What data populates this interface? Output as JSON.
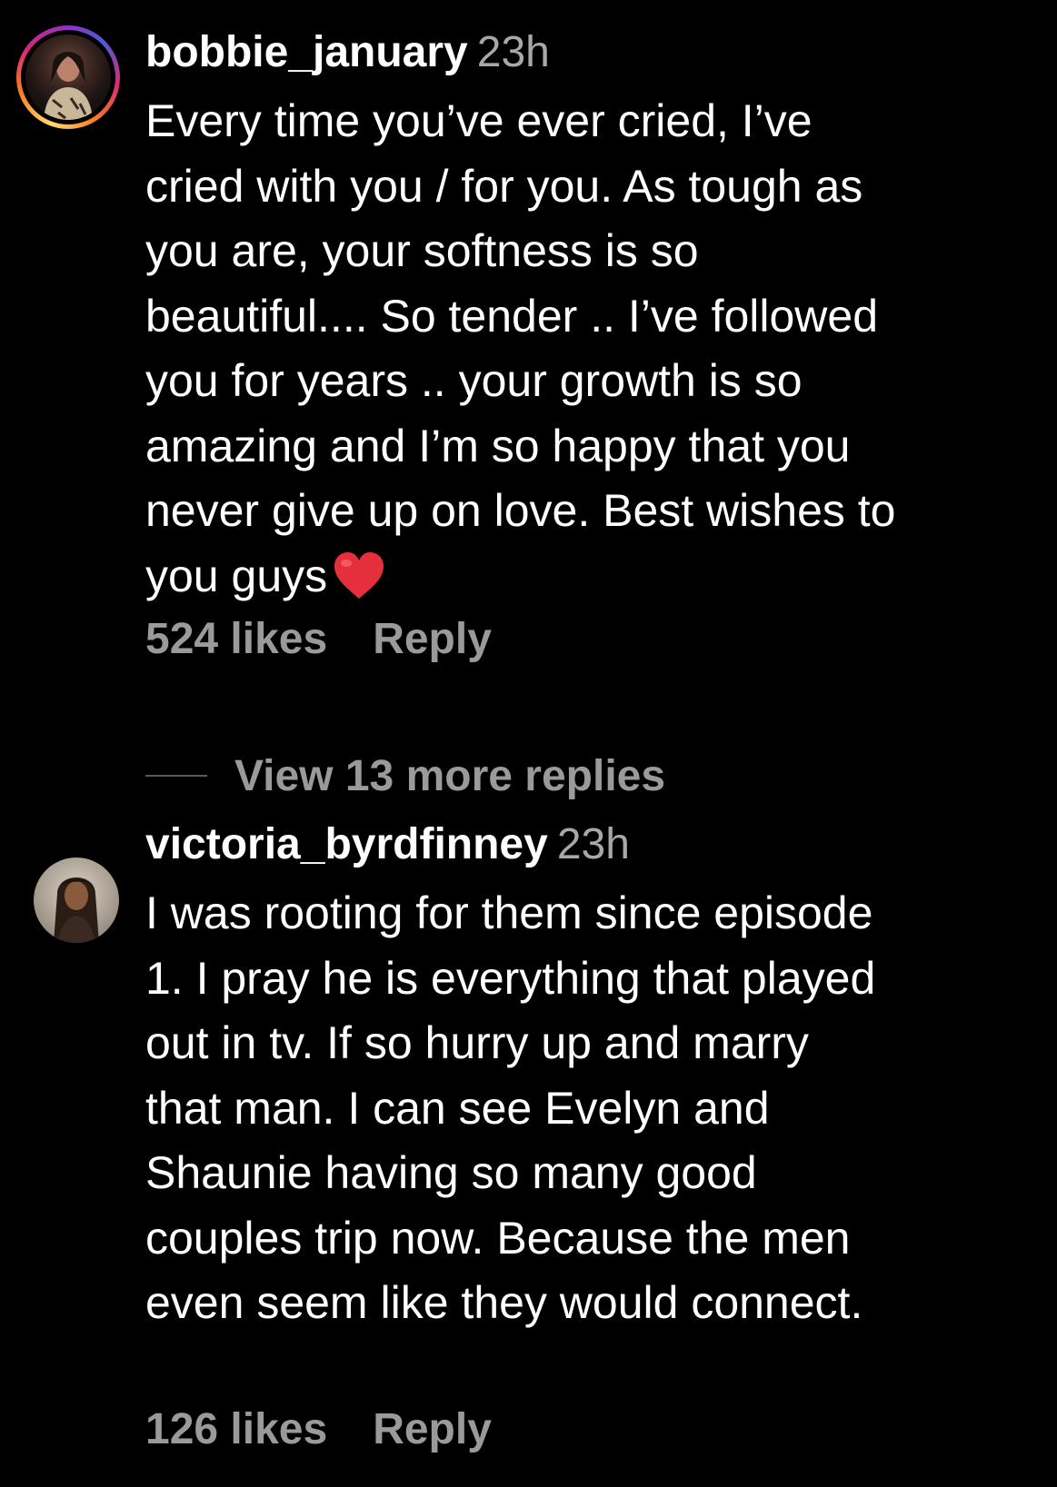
{
  "colors": {
    "background": "#000000",
    "text_primary": "#ffffff",
    "text_secondary": "#a8a8a8",
    "meta": "#9a9a9a",
    "heart": "#e52f3d"
  },
  "comments": [
    {
      "avatar_icon": "profile-photo-with-story-ring",
      "username": "bobbie_january",
      "time": "23h",
      "lines": [
        "Every time you’ve ever cried, I’ve",
        "cried with you / for you. As tough as",
        "you are, your softness is so",
        "beautiful.... So tender .. I’ve followed",
        "you for years .. your growth is so",
        "amazing and I’m so happy that you",
        "never give up on love. Best wishes to",
        "you guys"
      ],
      "emoji_icon": "red-heart-emoji",
      "likes": "524 likes",
      "reply_label": "Reply",
      "view_replies": "View 13 more replies"
    },
    {
      "avatar_icon": "profile-photo",
      "username": "victoria_byrdfinney",
      "time": "23h",
      "lines": [
        "I was rooting for them since episode",
        "1. I pray he is everything that played",
        "out in tv. If so hurry up and marry",
        "that man. I can see Evelyn and",
        "Shaunie having so many good",
        "couples trip now. Because the men",
        "even seem like they would connect."
      ],
      "likes": "126 likes",
      "reply_label": "Reply"
    }
  ]
}
